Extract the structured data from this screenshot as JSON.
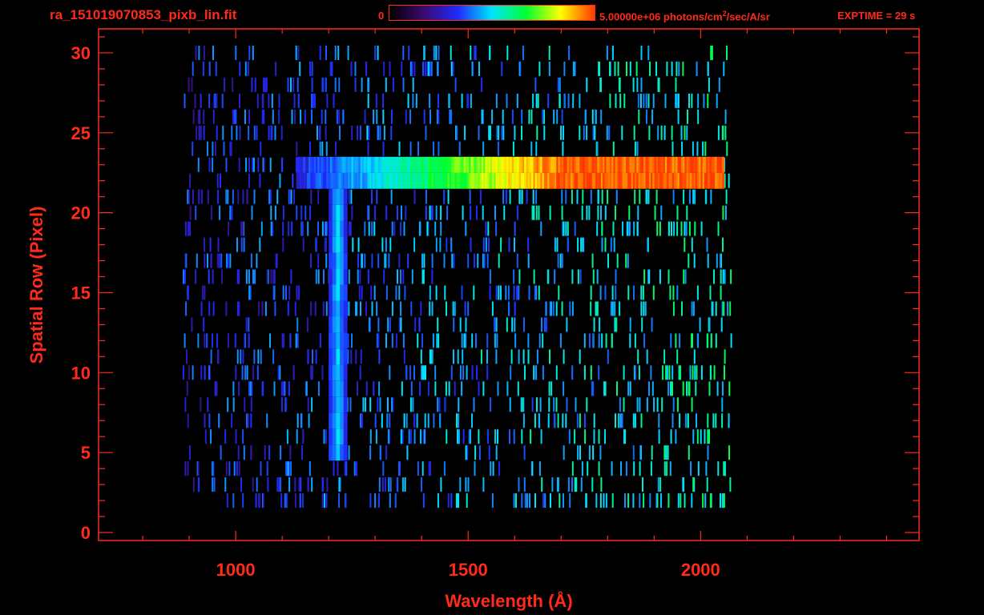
{
  "header": {
    "filename": "ra_151019070853_pixb_lin.fit",
    "colorbar_min": "0",
    "colorbar_max_prefix": "5.00000e+06 photons/cm",
    "colorbar_max_sup": "2",
    "colorbar_max_suffix": "/sec/A/sr",
    "exptime": "EXPTIME = 29 s"
  },
  "colors": {
    "axis": "#ff2a1a",
    "background": "#000000",
    "colormap": [
      "#000000",
      "#3a0a6e",
      "#1e2bff",
      "#00e5ff",
      "#00ff30",
      "#ffff00",
      "#ff3a00"
    ]
  },
  "chart_data": {
    "type": "heatmap",
    "xlabel": "Wavelength (Å)",
    "ylabel": "Spatial Row (Pixel)",
    "xlim": [
      705,
      2470
    ],
    "ylim": [
      -0.5,
      31.5
    ],
    "x_major_ticks": [
      1000,
      1500,
      2000
    ],
    "x_minor_step": 100,
    "y_major_ticks": [
      0,
      5,
      10,
      15,
      20,
      25,
      30
    ],
    "y_minor_step": 1,
    "color_scale": {
      "min": 0,
      "max": 5000000,
      "units": "photons/cm^2/sec/A/sr"
    },
    "data_extent_wavelength": [
      885,
      2065
    ],
    "data_extent_rows": [
      2,
      30
    ],
    "features": [
      {
        "name": "Lyman-alpha line",
        "wavelength": 1216,
        "rows": [
          5,
          21
        ],
        "level": 0.48
      },
      {
        "name": "spatial band",
        "wavelength_range": [
          1130,
          2050
        ],
        "rows": [
          22,
          23
        ],
        "level_start": 0.3,
        "level_end": 0.97
      }
    ],
    "noise_level_min": 0.18,
    "noise_level_max": 0.42
  }
}
